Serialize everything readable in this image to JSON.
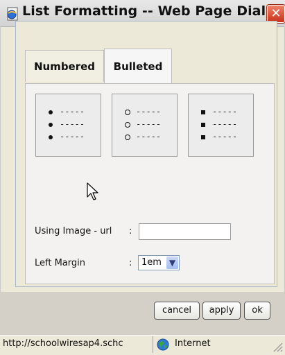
{
  "window": {
    "title": "List Formatting -- Web Page Dialog",
    "title_icon": "ie-page-icon",
    "close_label": "✕"
  },
  "tabs": [
    {
      "label": "Numbered",
      "selected": false
    },
    {
      "label": "Bulleted",
      "selected": true
    }
  ],
  "bullet_styles": [
    {
      "name": "disc",
      "rows": [
        "-----",
        "-----",
        "-----"
      ]
    },
    {
      "name": "circle",
      "rows": [
        "-----",
        "-----",
        "-----"
      ]
    },
    {
      "name": "square",
      "rows": [
        "-----",
        "-----",
        "-----"
      ]
    }
  ],
  "form": {
    "image_url_label": "Using Image - url",
    "image_url_colon": ":",
    "image_url_value": "",
    "left_margin_label": "Left Margin",
    "left_margin_colon": ":",
    "left_margin_value": "1em"
  },
  "buttons": {
    "cancel": "cancel",
    "apply": "apply",
    "ok": "ok"
  },
  "status": {
    "url": "http://schoolwiresap4.schc",
    "zone": "Internet"
  },
  "colors": {
    "close_red": "#d9442a",
    "dialog_bg": "#ece9d8",
    "select_arrow": "#a5bdf0"
  }
}
